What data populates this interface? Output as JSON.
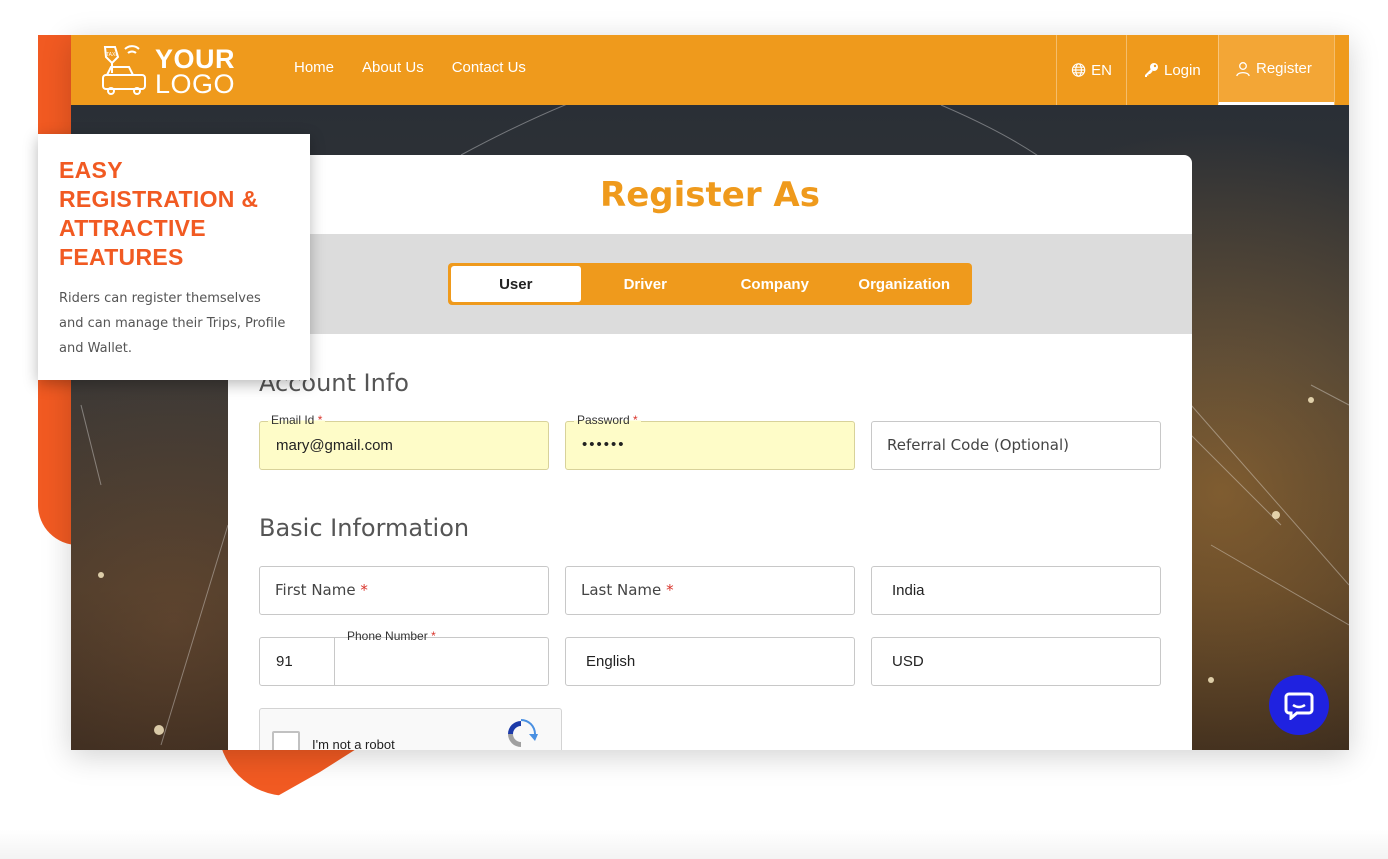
{
  "app": {
    "logo": {
      "line1": "YOUR",
      "line2": "LOGO",
      "badge": "TAXI"
    },
    "nav": [
      "Home",
      "About Us",
      "Contact Us"
    ],
    "right_nav": {
      "lang": "EN",
      "login": "Login",
      "register": "Register"
    }
  },
  "form": {
    "title": "Register As",
    "tabs": [
      "User",
      "Driver",
      "Company",
      "Organization"
    ],
    "active_tab": "User",
    "account_section": "Account Info",
    "email": {
      "label": "Email Id",
      "value": "mary@gmail.com"
    },
    "password": {
      "label": "Password",
      "value": "••••••"
    },
    "referral": {
      "placeholder": "Referral Code (Optional)"
    },
    "basic_section": "Basic Information",
    "first_name": {
      "placeholder": "First Name"
    },
    "last_name": {
      "placeholder": "Last Name"
    },
    "country": {
      "value": "India"
    },
    "phone": {
      "code": "91",
      "label": "Phone Number",
      "value": ""
    },
    "language": {
      "value": "English"
    },
    "currency": {
      "value": "USD"
    },
    "required_mark": "*",
    "captcha": {
      "label": "I'm not a robot"
    }
  },
  "promo": {
    "heading_lines": [
      "EASY",
      "REGISTRATION &",
      "ATTRACTIVE",
      "FEATURES"
    ],
    "body": "Riders can register themselves and can manage their Trips, Profile and Wallet."
  },
  "colors": {
    "brand": "#ef9a1c",
    "accent": "#f15a22",
    "chat": "#1f22e0"
  },
  "icons": [
    "taxi-logo-icon",
    "globe-icon",
    "key-icon",
    "user-icon",
    "recaptcha-icon",
    "chat-icon"
  ]
}
